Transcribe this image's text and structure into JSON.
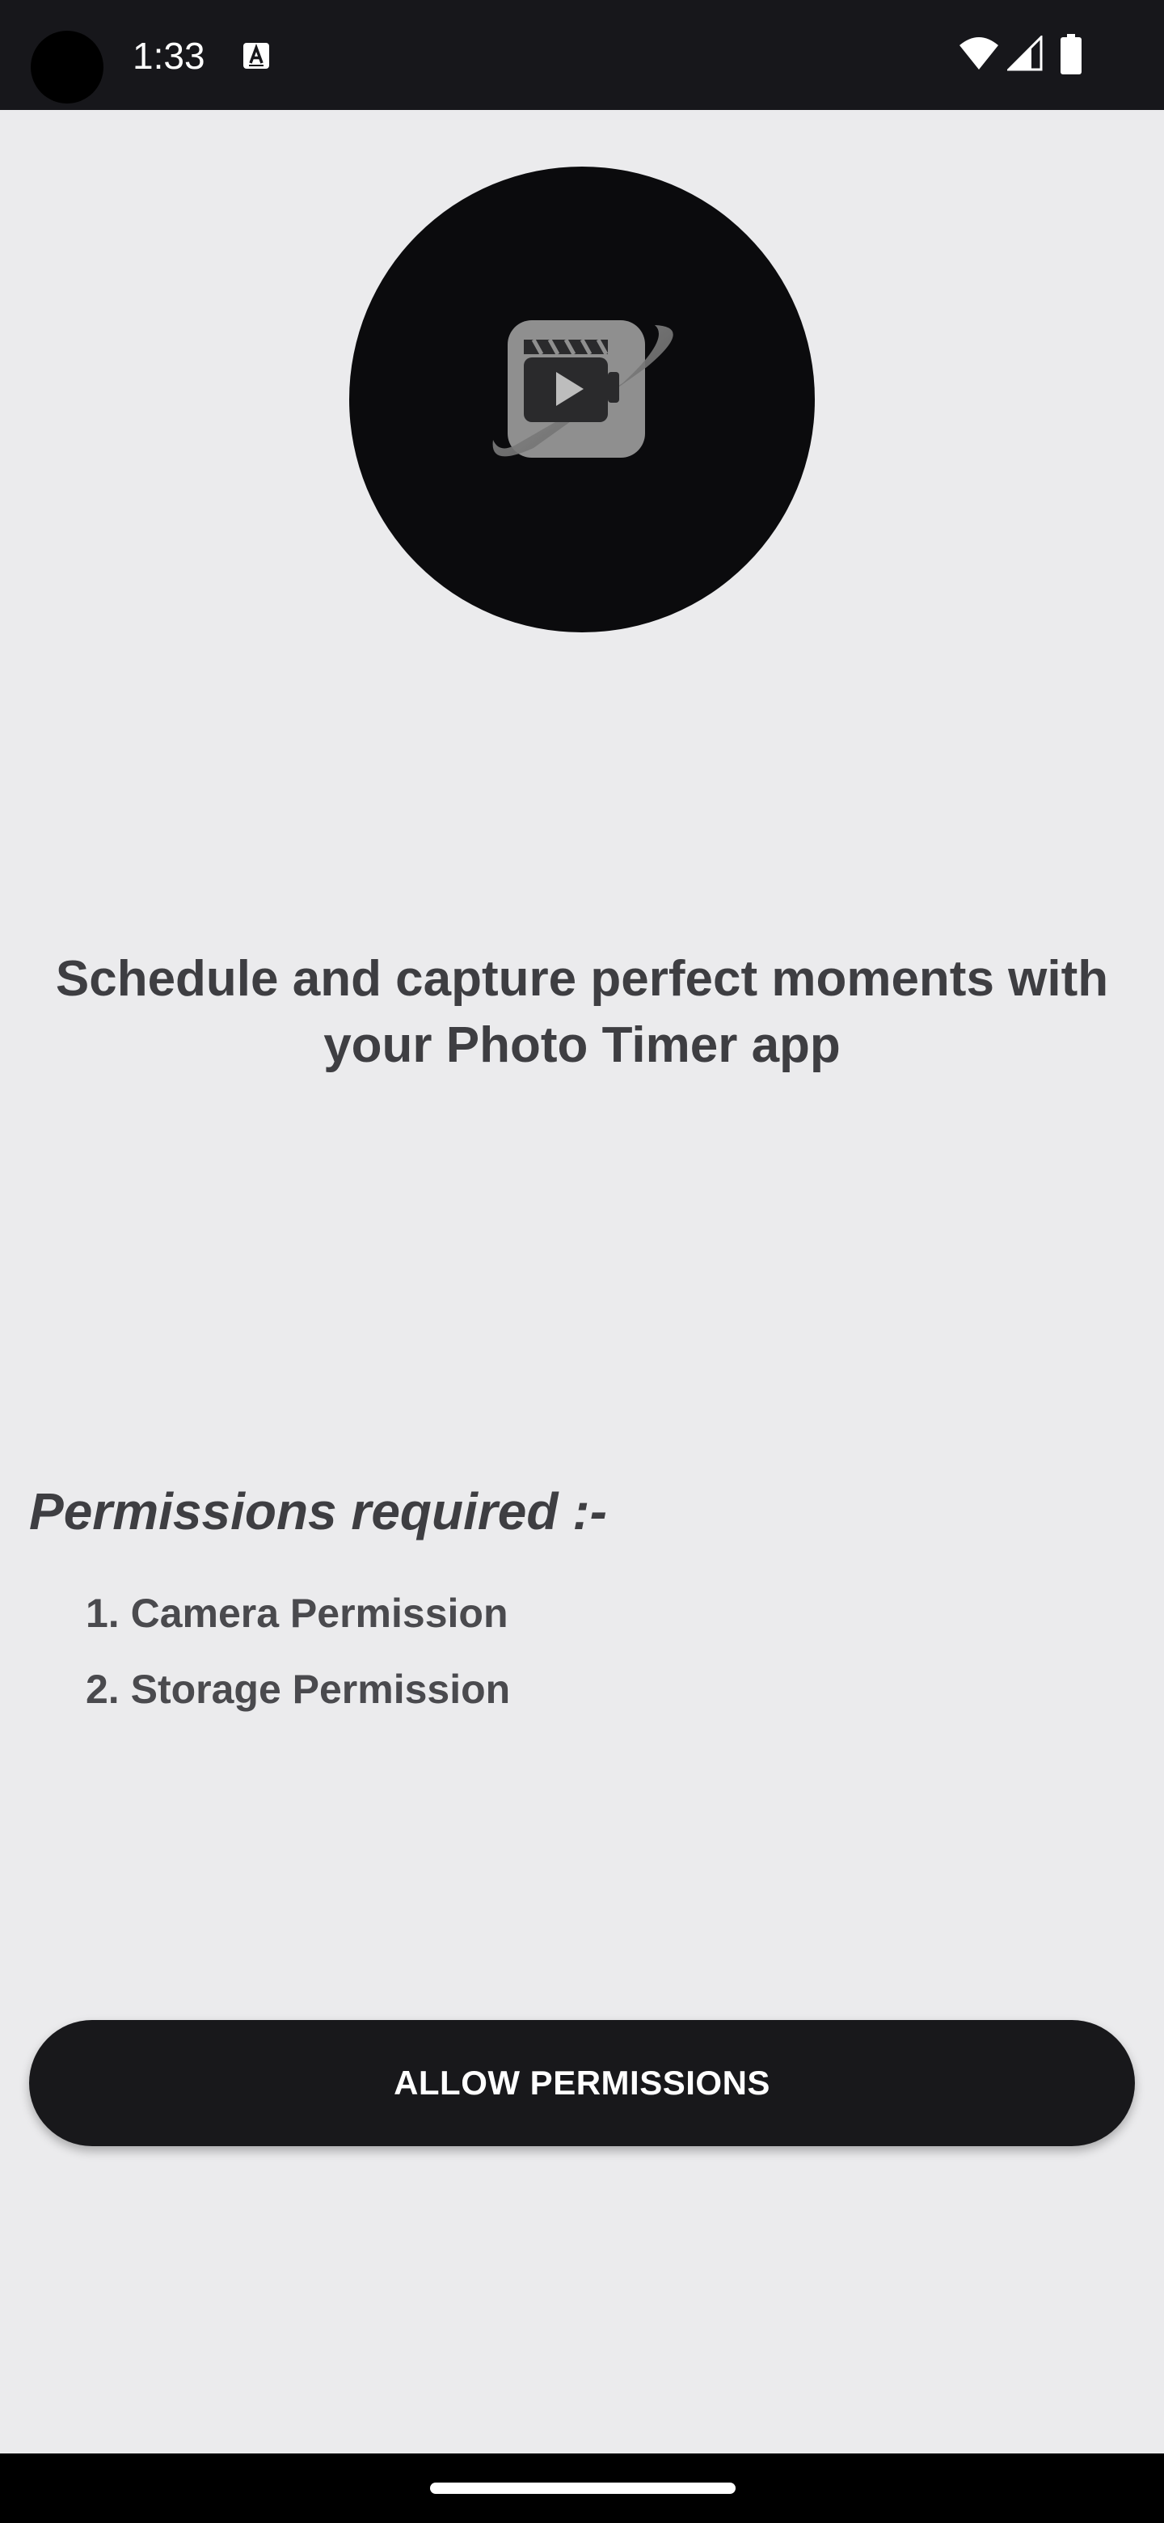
{
  "status_bar": {
    "time": "1:33",
    "notification_icon": "font-a-icon",
    "icons": [
      "wifi-icon",
      "signal-icon",
      "battery-icon"
    ]
  },
  "logo": {
    "icon": "video-clapper-icon",
    "background_color": "#0b0b0d"
  },
  "main": {
    "tagline": "Schedule and capture perfect moments with your Photo Timer app",
    "permissions_title": "Permissions required :-",
    "permissions": [
      "1. Camera Permission",
      "2. Storage Permission"
    ]
  },
  "actions": {
    "allow_label": "ALLOW PERMISSIONS"
  },
  "colors": {
    "background": "#ebebed",
    "button": "#18181b",
    "text": "#3e3e42"
  }
}
